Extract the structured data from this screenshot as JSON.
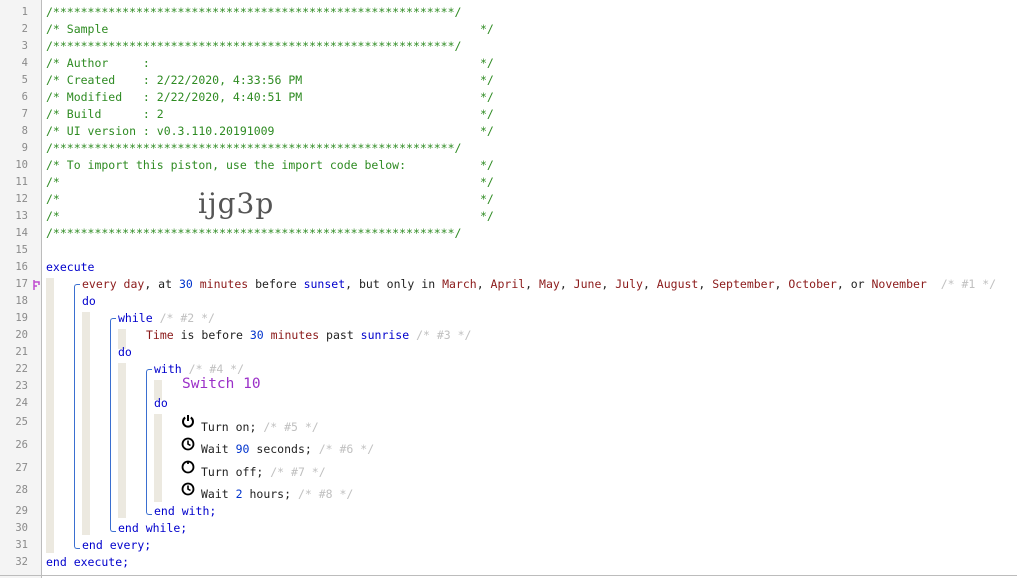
{
  "gutter": {
    "line_numbers": [
      "1",
      "2",
      "3",
      "4",
      "5",
      "6",
      "7",
      "8",
      "9",
      "10",
      "11",
      "12",
      "13",
      "14",
      "15",
      "16",
      "17",
      "18",
      "19",
      "20",
      "21",
      "22",
      "23",
      "24",
      "25",
      "26",
      "27",
      "28",
      "29",
      "30",
      "31",
      "32"
    ]
  },
  "header": {
    "rule": "/**********************************************************/",
    "sample": "/* Sample",
    "author": "/* Author     :",
    "created": "/* Created    : 2/22/2020, 4:33:56 PM",
    "modified": "/* Modified   : 2/22/2020, 4:40:51 PM",
    "build": "/* Build      : 2",
    "ui_version": "/* UI version : v0.3.110.20191009",
    "import_note": "/* To import this piston, use the import code below:",
    "blank": "/*",
    "close": "*/",
    "import_code": "ijg3p"
  },
  "code": {
    "execute": "execute",
    "every_parts": [
      "every day",
      ", at ",
      "30",
      " minutes",
      " before ",
      "sunset",
      ", but only in ",
      "March",
      ", ",
      "April",
      ", ",
      "May",
      ", ",
      "June",
      ", ",
      "July",
      ", ",
      "August",
      ", ",
      "September",
      ", ",
      "October",
      ", or ",
      "November"
    ],
    "every_comment": "/* #1 */",
    "do": "do",
    "while": "while",
    "while_comment": "/* #2 */",
    "cond_time": "Time",
    "cond_is": " is before ",
    "cond_num": "30",
    "cond_min": " minutes",
    "cond_past": " past ",
    "cond_sunrise": "sunrise",
    "cond_comment": "/* #3 */",
    "with": "with",
    "with_comment": "/* #4 */",
    "device": "Switch 10",
    "turn_on": "Turn on;",
    "turn_on_comment": "/* #5 */",
    "wait1_a": "Wait ",
    "wait1_num": "90",
    "wait1_b": " seconds;",
    "wait1_comment": "/* #6 */",
    "turn_off": "Turn off;",
    "turn_off_comment": "/* #7 */",
    "wait2_a": "Wait ",
    "wait2_num": "2",
    "wait2_b": " hours;",
    "wait2_comment": "/* #8 */",
    "end_with": "end with;",
    "end_while": "end while;",
    "end_every": "end every;",
    "end_execute": "end execute;"
  },
  "icons": [
    "power-icon",
    "clock-icon",
    "power-off-icon",
    "clock-icon"
  ]
}
